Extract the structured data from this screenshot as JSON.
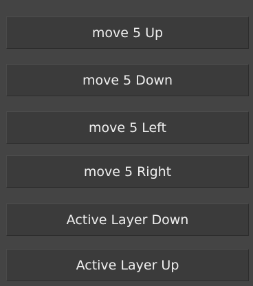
{
  "buttons": [
    {
      "label": "move 5 Up"
    },
    {
      "label": "move 5 Down"
    },
    {
      "label": "move 5 Left"
    },
    {
      "label": "move 5 Right"
    },
    {
      "label": "Active Layer Down"
    },
    {
      "label": "Active Layer Up"
    }
  ],
  "colors": {
    "panel_background": "#444444",
    "button_background": "#3b3b3b",
    "button_text": "#f0f0f0"
  }
}
